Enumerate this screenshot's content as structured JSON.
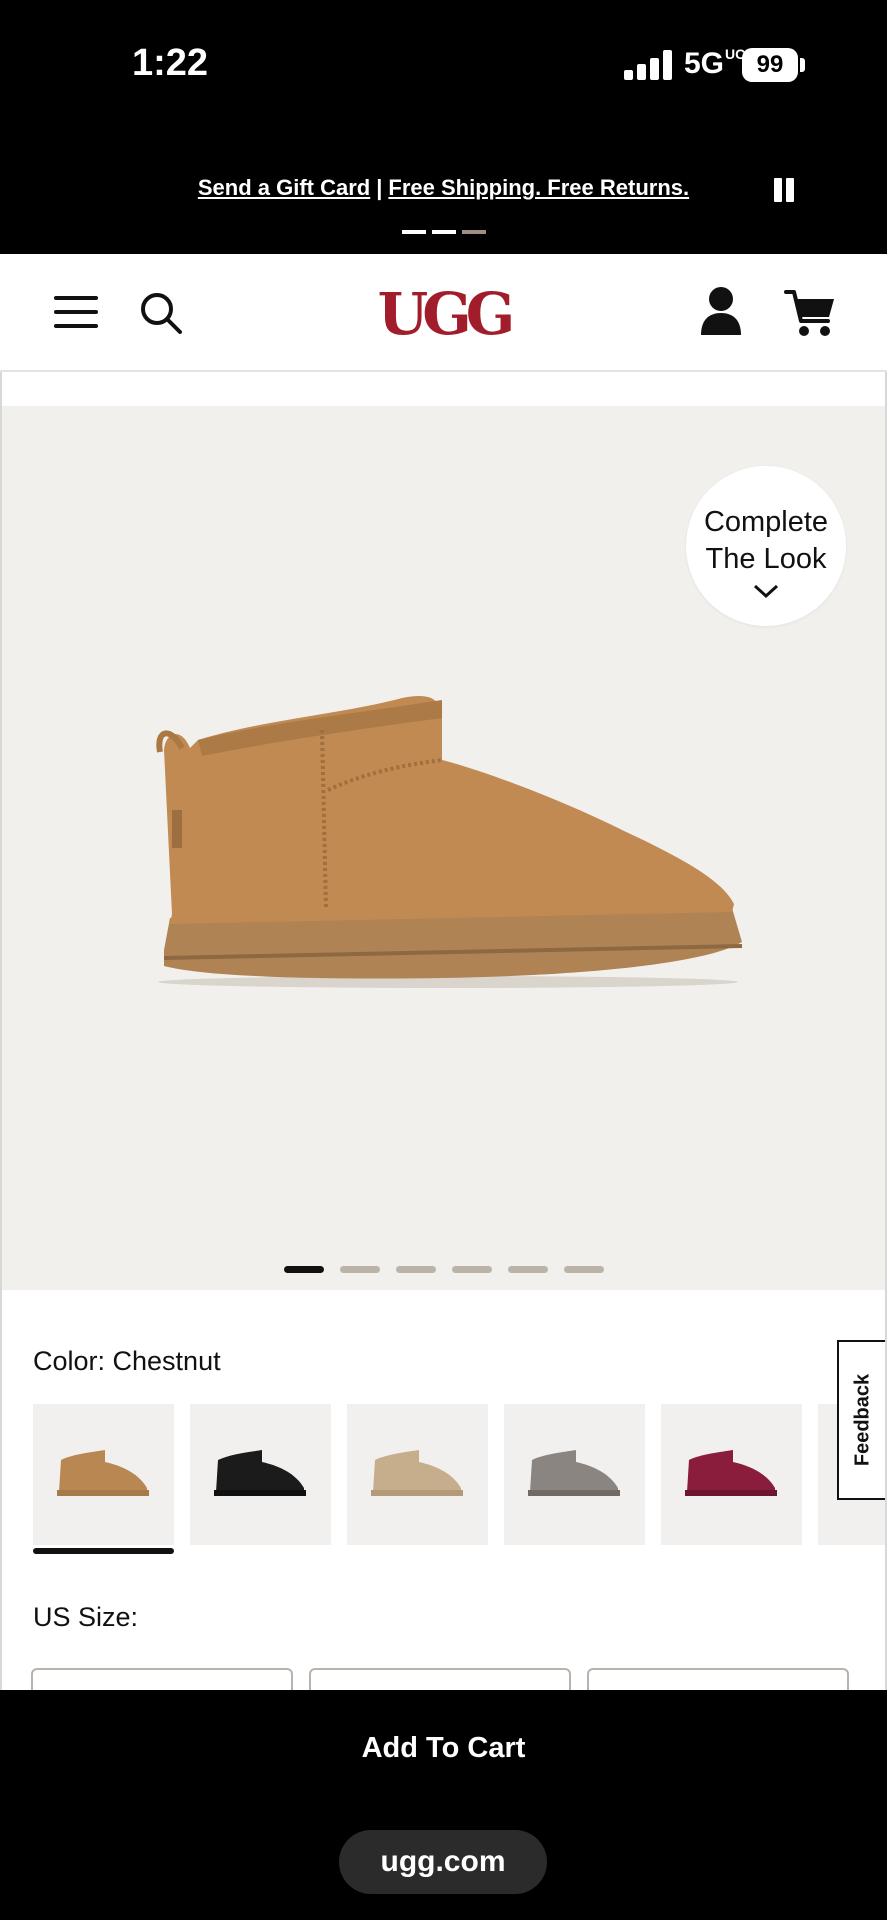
{
  "status_bar": {
    "time": "1:22",
    "network": "5G",
    "network_sup": "UC",
    "battery": "99"
  },
  "promo": {
    "link1": "Send a Gift Card",
    "separator": "|",
    "link2": "Free Shipping. Free Returns."
  },
  "header": {
    "logo": "UGG",
    "icons": [
      "menu-icon",
      "search-icon",
      "account-icon",
      "cart-icon"
    ]
  },
  "hero": {
    "complete_look_line1": "Complete",
    "complete_look_line2": "The Look",
    "image_count": 6,
    "active_image": 1
  },
  "color": {
    "label": "Color: Chestnut",
    "swatches": [
      {
        "name": "chestnut",
        "color": "#b98751",
        "selected": true
      },
      {
        "name": "black",
        "color": "#1b1b1b",
        "selected": false
      },
      {
        "name": "sand",
        "color": "#c6ad8c",
        "selected": false
      },
      {
        "name": "grey",
        "color": "#8a8580",
        "selected": false
      },
      {
        "name": "burgundy",
        "color": "#8a1d3b",
        "selected": false
      }
    ]
  },
  "feedback": {
    "label": "Feedback"
  },
  "size": {
    "label": "US Size:"
  },
  "cta": {
    "add_to_cart": "Add To Cart"
  },
  "browser": {
    "url": "ugg.com"
  },
  "colors": {
    "brand": "#a21d2b",
    "hero_bg": "#f2f0ed"
  }
}
